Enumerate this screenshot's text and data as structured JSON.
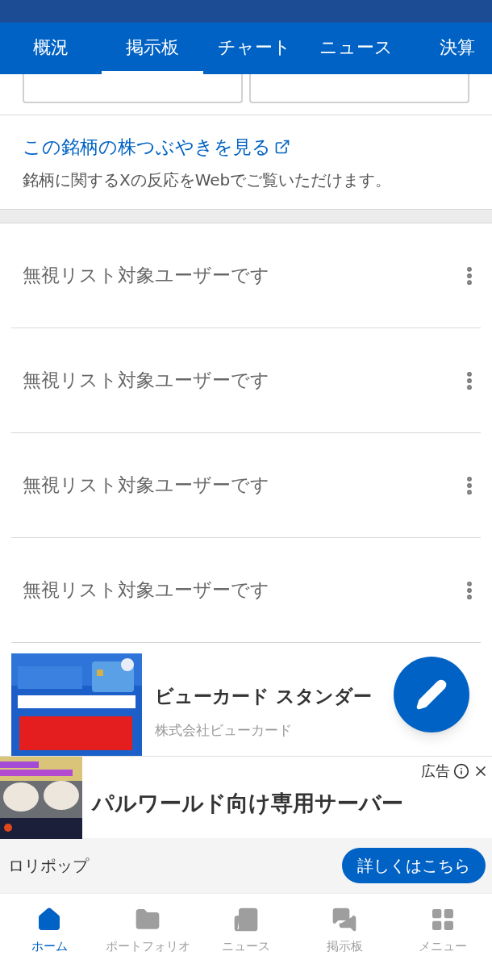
{
  "tabs": [
    {
      "label": "概況",
      "selected": false
    },
    {
      "label": "掲示板",
      "selected": true
    },
    {
      "label": "チャート",
      "selected": false
    },
    {
      "label": "ニュース",
      "selected": false
    },
    {
      "label": "決算",
      "selected": false
    }
  ],
  "tweets": {
    "link": "この銘柄の株つぶやきを見る",
    "description": "銘柄に関するXの反応をWebでご覧いただけます。"
  },
  "posts": [
    {
      "text": "無視リスト対象ユーザーです"
    },
    {
      "text": "無視リスト対象ユーザーです"
    },
    {
      "text": "無視リスト対象ユーザーです"
    },
    {
      "text": "無視リスト対象ユーザーです"
    }
  ],
  "sponsored": {
    "title": "ビューカード スタンダー",
    "advertiser": "株式会社ビューカード"
  },
  "banner": {
    "label": "広告",
    "headline": "パルワールド向け専用サーバー",
    "advertiser": "ロリポップ",
    "cta": "詳しくはこちら"
  },
  "bottom_nav": [
    {
      "label": "ホーム",
      "selected": true
    },
    {
      "label": "ポートフォリオ",
      "selected": false
    },
    {
      "label": "ニュース",
      "selected": false
    },
    {
      "label": "掲示板",
      "selected": false
    },
    {
      "label": "メニュー",
      "selected": false
    }
  ]
}
